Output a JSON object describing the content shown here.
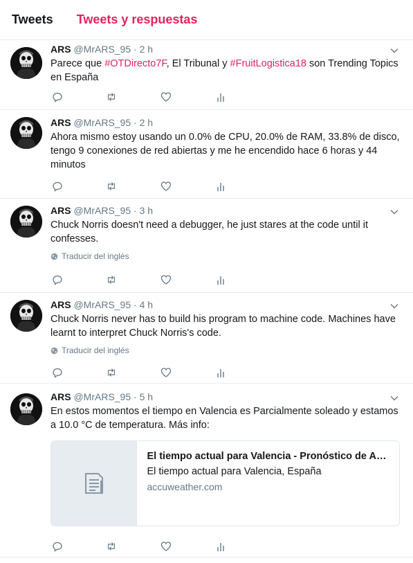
{
  "tabs": {
    "tweets": "Tweets",
    "tweets_replies": "Tweets y respuestas"
  },
  "translate_label": "Traducir del inglés",
  "tweets": [
    {
      "name": "ARS",
      "handle": "@MrARS_95",
      "time": "2 h",
      "text_parts": [
        "Parece que ",
        "#OTDirecto7F",
        ", El Tribunal y ",
        "#FruitLogistica18",
        " son Trending Topics en España"
      ]
    },
    {
      "name": "ARS",
      "handle": "@MrARS_95",
      "time": "2 h",
      "text": "Ahora mismo estoy usando un 0.0% de CPU, 20.0% de RAM, 33.8% de disco, tengo 9 conexiones de red abiertas y me he encendido hace 6 horas y 44 minutos"
    },
    {
      "name": "ARS",
      "handle": "@MrARS_95",
      "time": "3 h",
      "text": "Chuck Norris doesn't need a debugger, he just stares at the code until it confesses."
    },
    {
      "name": "ARS",
      "handle": "@MrARS_95",
      "time": "4 h",
      "text": "Chuck Norris never has to build his program to machine code. Machines have learnt to interpret Chuck Norris's code."
    },
    {
      "name": "ARS",
      "handle": "@MrARS_95",
      "time": "5 h",
      "text": "En estos momentos el tiempo en Valencia es Parcialmente soleado y estamos a 10.0 °C de temperatura. Más info:",
      "card": {
        "title": "El tiempo actual para Valencia - Pronóstico de Acc...",
        "description": "El tiempo actual para Valencia, España",
        "domain": "accuweather.com"
      }
    }
  ],
  "separator": "·",
  "colors": {
    "accent": "#e0245e",
    "secondary_text": "#657786",
    "border": "#e6ecf0"
  },
  "icons": {
    "reply": "reply-icon",
    "retweet": "retweet-icon",
    "like": "heart-icon",
    "analytics": "analytics-icon",
    "more": "chevron-down-icon",
    "translate": "globe-icon",
    "card": "document-icon"
  }
}
